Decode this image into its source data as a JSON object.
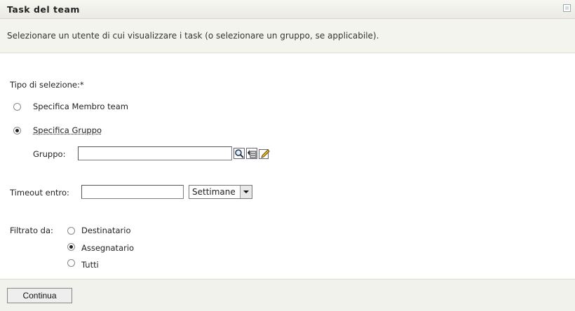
{
  "header": {
    "title": "Task del team",
    "grip_icon": "grid-icon"
  },
  "intro_text": "Selezionare un utente di cui visualizzare i task (o selezionare un gruppo, se applicabile).",
  "selection": {
    "label": "Tipo di selezione:*",
    "options": [
      {
        "label": "Specifica Membro team",
        "selected": false
      },
      {
        "label": "Specifica Gruppo",
        "selected": true
      }
    ]
  },
  "gruppo": {
    "label": "Gruppo:",
    "value": "",
    "icons": [
      "search-icon",
      "history-icon",
      "edit-icon"
    ]
  },
  "timeout": {
    "label": "Timeout entro:",
    "value": "",
    "unit_selected": "Settimane"
  },
  "filter": {
    "label": "Filtrato da:",
    "options": [
      {
        "label": "Destinatario",
        "selected": false
      },
      {
        "label": "Assegnatario",
        "selected": true
      },
      {
        "label": "Tutti",
        "selected": false
      }
    ]
  },
  "footer": {
    "continue_label": "Continua"
  }
}
